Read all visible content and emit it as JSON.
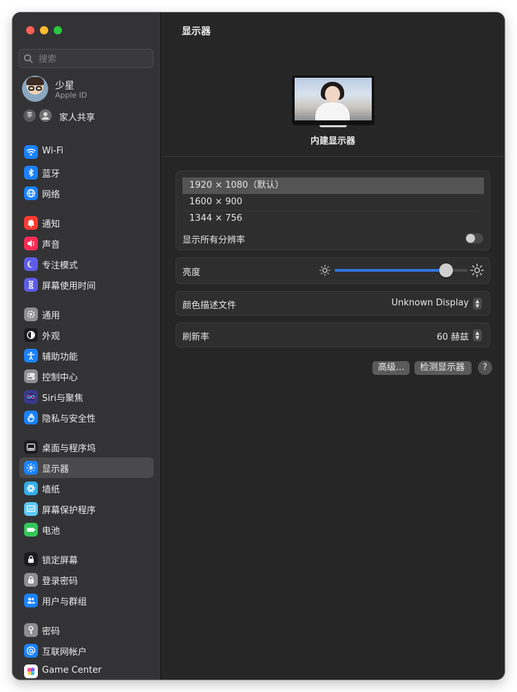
{
  "window": {
    "controls": [
      "close",
      "minimize",
      "zoom"
    ],
    "colors": {
      "close": "#ff5f57",
      "minimize": "#febc2e",
      "zoom": "#28c840"
    }
  },
  "sidebar": {
    "search_placeholder": "搜索",
    "profile": {
      "name": "少星",
      "subtitle": "Apple ID"
    },
    "family": {
      "avatar1": "李",
      "label": "家人共享"
    },
    "groups": [
      [
        {
          "label": "Wi-Fi",
          "icon": "wifi-icon",
          "color": "#1a82ff"
        },
        {
          "label": "蓝牙",
          "icon": "bluetooth-icon",
          "color": "#1a82ff"
        },
        {
          "label": "网络",
          "icon": "globe-icon",
          "color": "#1a82ff"
        }
      ],
      [
        {
          "label": "通知",
          "icon": "bell-icon",
          "color": "#ff3b30"
        },
        {
          "label": "声音",
          "icon": "speaker-icon",
          "color": "#ff2d55"
        },
        {
          "label": "专注模式",
          "icon": "moon-icon",
          "color": "#5e5ce6"
        },
        {
          "label": "屏幕使用时间",
          "icon": "hourglass-icon",
          "color": "#5e5ce6"
        }
      ],
      [
        {
          "label": "通用",
          "icon": "gear-icon",
          "color": "#8e8e93"
        },
        {
          "label": "外观",
          "icon": "appearance-icon",
          "color": "#1c1c1e"
        },
        {
          "label": "辅助功能",
          "icon": "accessibility-icon",
          "color": "#1a82ff"
        },
        {
          "label": "控制中心",
          "icon": "control-center-icon",
          "color": "#8e8e93"
        },
        {
          "label": "Siri与聚焦",
          "icon": "siri-icon",
          "color": "#3a3a8c"
        },
        {
          "label": "隐私与安全性",
          "icon": "hand-icon",
          "color": "#1a82ff"
        }
      ],
      [
        {
          "label": "桌面与程序坞",
          "icon": "dock-icon",
          "color": "#1c1c1e"
        },
        {
          "label": "显示器",
          "icon": "brightness-icon",
          "color": "#1a82ff",
          "active": true
        },
        {
          "label": "墙纸",
          "icon": "wallpaper-icon",
          "color": "#32ade6"
        },
        {
          "label": "屏幕保护程序",
          "icon": "screensaver-icon",
          "color": "#5ac8fa"
        },
        {
          "label": "电池",
          "icon": "battery-icon",
          "color": "#34c759"
        }
      ],
      [
        {
          "label": "锁定屏幕",
          "icon": "lock-icon",
          "color": "#1c1c1e"
        },
        {
          "label": "登录密码",
          "icon": "padlock-icon",
          "color": "#8e8e93"
        },
        {
          "label": "用户与群组",
          "icon": "users-icon",
          "color": "#1a82ff"
        }
      ],
      [
        {
          "label": "密码",
          "icon": "key-icon",
          "color": "#8e8e93"
        },
        {
          "label": "互联网帐户",
          "icon": "at-icon",
          "color": "#1a82ff"
        },
        {
          "label": "Game Center",
          "icon": "game-center-icon",
          "color": "#ffffff"
        }
      ]
    ]
  },
  "main": {
    "title": "显示器",
    "monitor_label": "内建显示器",
    "resolutions": [
      "1920 × 1080（默认）",
      "1600 × 900",
      "1344 × 756"
    ],
    "show_all_label": "显示所有分辨率",
    "show_all_enabled": false,
    "brightness_label": "亮度",
    "brightness_level": 0.84,
    "color_profile_label": "颜色描述文件",
    "color_profile_value": "Unknown Display",
    "refresh_label": "刷新率",
    "refresh_value": "60 赫兹",
    "advanced_button": "高级...",
    "detect_button": "检测显示器",
    "help_button": "?",
    "accent_color": "#2f74e0"
  }
}
